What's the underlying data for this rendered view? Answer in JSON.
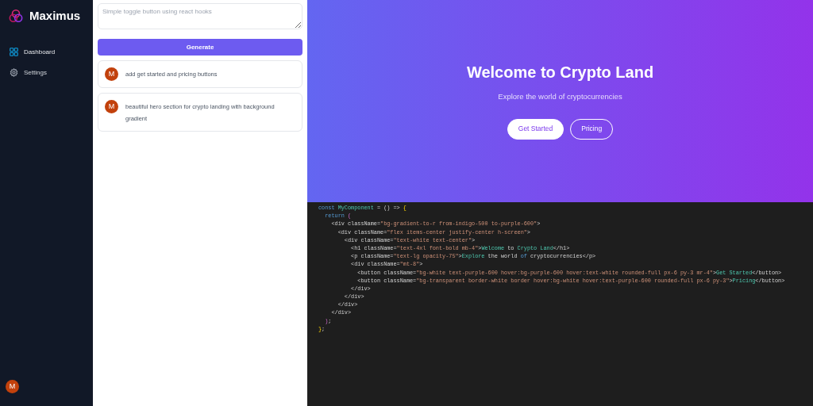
{
  "sidebar": {
    "brand": "Maximus",
    "items": [
      {
        "label": "Dashboard",
        "kind": "grid",
        "selected": true
      },
      {
        "label": "Settings",
        "kind": "gear",
        "selected": false
      }
    ],
    "user_avatar": "M"
  },
  "prompt": {
    "placeholder": "Simple toggle button using react hooks",
    "button": "Generate"
  },
  "history": [
    {
      "avatar": "M",
      "text": "add get started and pricing buttons"
    },
    {
      "avatar": "M",
      "text": "beautiful hero section for crypto landing with background gradient"
    }
  ],
  "preview": {
    "title": "Welcome to Crypto Land",
    "subtitle": "Explore the world of cryptocurrencies",
    "buttons": [
      {
        "label": "Get Started",
        "kind": "solid"
      },
      {
        "label": "Pricing",
        "kind": "outline"
      }
    ]
  },
  "code": [
    {
      "tokens": [
        {
          "kind": "kw",
          "text": "const "
        },
        {
          "kind": "fn",
          "text": "MyComponent"
        },
        {
          "kind": "plain",
          "text": " = () => "
        },
        {
          "kind": "brace",
          "text": "{"
        }
      ]
    },
    {
      "tokens": [
        {
          "kind": "kw",
          "text": "  return "
        },
        {
          "kind": "brace2",
          "text": "("
        }
      ]
    },
    {
      "tokens": [
        {
          "kind": "plain",
          "text": "    <div className="
        },
        {
          "kind": "str",
          "text": "\"bg-gradient-to-r from-indigo-500 to-purple-600\""
        },
        {
          "kind": "plain",
          "text": ">"
        }
      ]
    },
    {
      "tokens": [
        {
          "kind": "plain",
          "text": "      <div className="
        },
        {
          "kind": "str",
          "text": "\"flex items-center justify-center h-screen\""
        },
        {
          "kind": "plain",
          "text": ">"
        }
      ]
    },
    {
      "tokens": [
        {
          "kind": "plain",
          "text": "        <div className="
        },
        {
          "kind": "str",
          "text": "\"text-white text-center\""
        },
        {
          "kind": "plain",
          "text": ">"
        }
      ]
    },
    {
      "tokens": [
        {
          "kind": "plain",
          "text": "          <h1 className="
        },
        {
          "kind": "str",
          "text": "\"text-4xl font-bold mb-4\""
        },
        {
          "kind": "plain",
          "text": ">"
        },
        {
          "kind": "jsx",
          "text": "Welcome"
        },
        {
          "kind": "plain",
          "text": " to "
        },
        {
          "kind": "jsx",
          "text": "Crypto Land"
        },
        {
          "kind": "plain",
          "text": "</h1>"
        }
      ]
    },
    {
      "tokens": [
        {
          "kind": "plain",
          "text": "          <p className="
        },
        {
          "kind": "str",
          "text": "\"text-lg opacity-75\""
        },
        {
          "kind": "plain",
          "text": ">"
        },
        {
          "kind": "jsx",
          "text": "Explore"
        },
        {
          "kind": "plain",
          "text": " the world "
        },
        {
          "kind": "kw",
          "text": "of"
        },
        {
          "kind": "plain",
          "text": " cryptocurrencies</p>"
        }
      ]
    },
    {
      "tokens": [
        {
          "kind": "plain",
          "text": "          <div className="
        },
        {
          "kind": "str",
          "text": "\"mt-8\""
        },
        {
          "kind": "plain",
          "text": ">"
        }
      ]
    },
    {
      "tokens": [
        {
          "kind": "plain",
          "text": "            <button className="
        },
        {
          "kind": "str",
          "text": "\"bg-white text-purple-600 hover:bg-purple-600 hover:text-white rounded-full px-6 py-3 mr-4\""
        },
        {
          "kind": "plain",
          "text": ">"
        },
        {
          "kind": "jsx",
          "text": "Get Started"
        },
        {
          "kind": "plain",
          "text": "</button>"
        }
      ]
    },
    {
      "tokens": [
        {
          "kind": "plain",
          "text": "            <button className="
        },
        {
          "kind": "str",
          "text": "\"bg-transparent border-white border hover:bg-white hover:text-purple-600 rounded-full px-6 py-3\""
        },
        {
          "kind": "plain",
          "text": ">"
        },
        {
          "kind": "jsx",
          "text": "Pricing"
        },
        {
          "kind": "plain",
          "text": "</button>"
        }
      ]
    },
    {
      "tokens": [
        {
          "kind": "plain",
          "text": "          </div>"
        }
      ]
    },
    {
      "tokens": [
        {
          "kind": "plain",
          "text": "        </div>"
        }
      ]
    },
    {
      "tokens": [
        {
          "kind": "plain",
          "text": "      </div>"
        }
      ]
    },
    {
      "tokens": [
        {
          "kind": "plain",
          "text": "    </div>"
        }
      ]
    },
    {
      "tokens": [
        {
          "kind": "brace2",
          "text": "  )"
        },
        {
          "kind": "plain",
          "text": ";"
        }
      ]
    },
    {
      "tokens": [
        {
          "kind": "brace",
          "text": "}"
        },
        {
          "kind": "plain",
          "text": ";"
        }
      ]
    }
  ]
}
